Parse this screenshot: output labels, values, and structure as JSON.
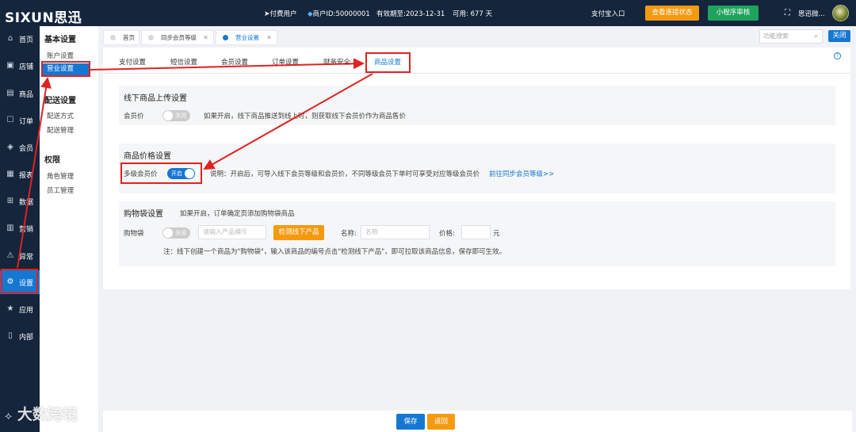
{
  "header": {
    "logo": "SIXUN思迅",
    "paid_user": "付费用户",
    "merchant_id": "商户ID:50000001",
    "valid_until": "有效期至:2023-12-31",
    "available": "可用: 677 天",
    "alipay_entry": "支付宝入口",
    "check_connection": "查看连接状态",
    "mini_program_review": "小程序审核",
    "user_name": "思迅微..."
  },
  "sidebar": {
    "items": [
      {
        "label": "首页",
        "icon": "home-icon"
      },
      {
        "label": "店铺",
        "icon": "store-icon"
      },
      {
        "label": "商品",
        "icon": "goods-icon"
      },
      {
        "label": "订单",
        "icon": "order-icon"
      },
      {
        "label": "会员",
        "icon": "member-icon"
      },
      {
        "label": "报表",
        "icon": "report-icon"
      },
      {
        "label": "数据",
        "icon": "data-icon"
      },
      {
        "label": "营销",
        "icon": "marketing-icon"
      },
      {
        "label": "异常",
        "icon": "warning-icon"
      },
      {
        "label": "设置",
        "icon": "gear-icon"
      },
      {
        "label": "应用",
        "icon": "star-icon"
      },
      {
        "label": "内部",
        "icon": "document-icon"
      }
    ],
    "active_index": 9
  },
  "submenu": {
    "basic_heading": "基本设置",
    "account_settings": "账户设置",
    "business_settings": "营业设置",
    "delivery_heading": "配送设置",
    "delivery_method": "配送方式",
    "delivery_management": "配送管理",
    "permission_heading": "权限",
    "role_management": "角色管理",
    "staff_management": "员工管理"
  },
  "page_tabs": [
    {
      "label": "首页"
    },
    {
      "label": "同步会员等级"
    },
    {
      "label": "营业设置"
    }
  ],
  "search": {
    "placeholder": "功能搜索"
  },
  "close_label": "关闭",
  "settings_tabs": [
    "支付设置",
    "短信设置",
    "会员设置",
    "订单设置",
    "财务安全",
    "商品设置"
  ],
  "offline_section": {
    "title": "线下商品上传设置",
    "member_price_label": "会员价",
    "toggle_text": "关闭",
    "toggle_on": false,
    "description": "如果开启，线下商品推送到线上时，则获取线下会员价作为商品售价"
  },
  "price_section": {
    "title": "商品价格设置",
    "multi_level_label": "多级会员价",
    "toggle_text": "开启",
    "toggle_on": true,
    "description": "说明：开启后，可导入线下会员等级和会员价，不同等级会员下单时可享受对应等级会员价",
    "sync_link": "前往同步会员等级>>"
  },
  "bag_section": {
    "title": "购物袋设置",
    "subtitle": "如果开启，订单确定页添加购物袋商品",
    "bag_label": "购物袋",
    "toggle_text": "关闭",
    "toggle_on": false,
    "product_code_placeholder": "请输入产品编号",
    "detect_button": "检测线下产品",
    "name_label": "名称:",
    "name_placeholder": "名称",
    "price_label": "价格:",
    "unit": "元",
    "note": "注：线下创建一个商品为\"购物袋\"，输入该商品的编号点击\"检测线下产品\"，即可拉取该商品信息，保存即可生效。"
  },
  "footer": {
    "save": "保存",
    "back": "返回"
  },
  "watermark": "大数跨境",
  "colors": {
    "accent": "#1677d2",
    "sidebar_bg": "#14253c",
    "orange": "#f59a10",
    "green": "#1fa35c",
    "annotation_red": "#e02222"
  }
}
